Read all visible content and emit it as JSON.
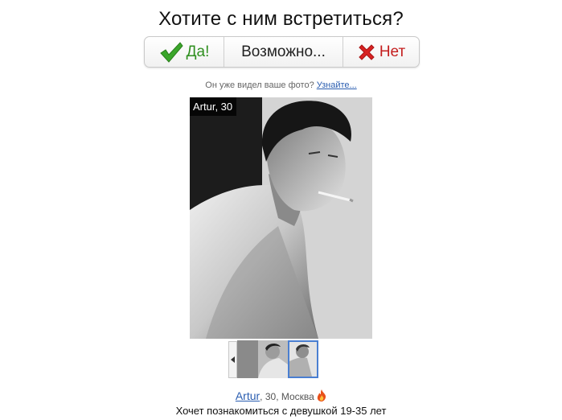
{
  "question": "Хотите с ним встретиться?",
  "choices": {
    "yes_label": "Да!",
    "maybe_label": "Возможно...",
    "no_label": "Нет"
  },
  "seen_photo": {
    "text": "Он уже видел ваше фото?",
    "link": "Узнайте..."
  },
  "photo": {
    "name_age_tag": "Artur, 30"
  },
  "profile": {
    "name": "Artur",
    "details": ", 30, Москва",
    "wants": "Хочет познакомиться с девушкой 19-35 лет"
  },
  "colors": {
    "yes": "#2f8f1f",
    "no": "#c41e1e",
    "link": "#2a5db0",
    "thumb_selected": "#4a7fd1"
  },
  "icons": {
    "yes": "checkmark-icon",
    "no": "cross-icon",
    "prev": "triangle-left-icon",
    "hot": "fire-icon"
  }
}
